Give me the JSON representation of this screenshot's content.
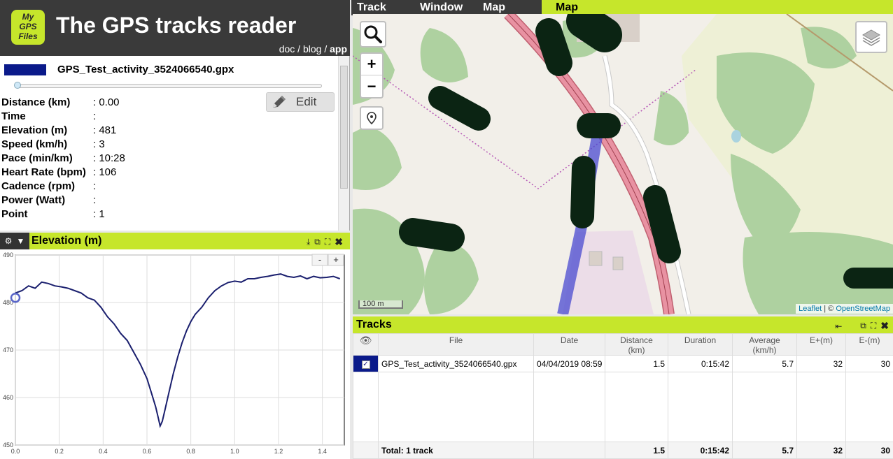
{
  "header": {
    "logo_lines": [
      "My",
      "GPS",
      "Files"
    ],
    "title": "The GPS tracks reader",
    "links": {
      "doc": "doc",
      "sep1": " / ",
      "blog": "blog",
      "sep2": " / ",
      "app": "app"
    }
  },
  "info": {
    "track_name": "GPS_Test_activity_3524066540.gpx",
    "track_color": "#0a1a8a",
    "edit_label": "Edit",
    "rows": [
      {
        "label": "Distance (km)",
        "value": ": 0.00"
      },
      {
        "label": "Time",
        "value": ":"
      },
      {
        "label": "Elevation (m)",
        "value": ": 481"
      },
      {
        "label": "Speed (km/h)",
        "value": ": 3"
      },
      {
        "label": "Pace (min/km)",
        "value": ": 10:28"
      },
      {
        "label": "Heart Rate (bpm)",
        "value": ": 106"
      },
      {
        "label": "Cadence (rpm)",
        "value": ":"
      },
      {
        "label": "Power (Watt)",
        "value": ":"
      },
      {
        "label": "Point",
        "value": ": 1"
      }
    ]
  },
  "elevation": {
    "title": "Elevation (m)",
    "zoom_out": "-",
    "zoom_in": "+"
  },
  "chart_data": {
    "type": "line",
    "xlabel": "",
    "ylabel": "",
    "xlim": [
      0,
      1.5
    ],
    "ylim": [
      450,
      490
    ],
    "xticks": [
      "0.0",
      "0.2",
      "0.4",
      "0.6",
      "0.8",
      "1.0",
      "1.2",
      "1.4"
    ],
    "yticks": [
      "450",
      "460",
      "470",
      "480",
      "490"
    ],
    "line_color": "#1a1f6e",
    "cursor_point": [
      0.0,
      481
    ],
    "x": [
      0.0,
      0.03,
      0.06,
      0.09,
      0.12,
      0.15,
      0.18,
      0.21,
      0.24,
      0.27,
      0.3,
      0.33,
      0.36,
      0.39,
      0.42,
      0.45,
      0.48,
      0.51,
      0.54,
      0.57,
      0.6,
      0.62,
      0.64,
      0.65,
      0.66,
      0.67,
      0.68,
      0.7,
      0.72,
      0.74,
      0.76,
      0.78,
      0.8,
      0.82,
      0.85,
      0.88,
      0.91,
      0.94,
      0.97,
      1.0,
      1.03,
      1.06,
      1.09,
      1.12,
      1.15,
      1.18,
      1.21,
      1.24,
      1.27,
      1.3,
      1.33,
      1.36,
      1.39,
      1.42,
      1.45,
      1.48
    ],
    "y": [
      482,
      482.5,
      483.5,
      483,
      484.3,
      484,
      483.5,
      483.3,
      483,
      482.5,
      482,
      481,
      480.5,
      479,
      477,
      475.5,
      473.5,
      472,
      469.5,
      467,
      464,
      461,
      458,
      456,
      454,
      455,
      457,
      461,
      465,
      468.5,
      471.5,
      474,
      476,
      477.5,
      479,
      481,
      482.5,
      483.5,
      484.2,
      484.5,
      484.3,
      485,
      485,
      485.3,
      485.5,
      485.8,
      486,
      485.5,
      485.3,
      485.6,
      485,
      485.5,
      485.2,
      485.3,
      485.5,
      485
    ]
  },
  "map": {
    "menu": [
      "Track",
      "Window",
      "Map"
    ],
    "tab_title": "Map",
    "zoom_in": "+",
    "zoom_out": "−",
    "scale": "100 m",
    "attribution_leaflet": "Leaflet",
    "attribution_sep": " | © ",
    "attribution_osm": "OpenStreetMap"
  },
  "tracks": {
    "title": "Tracks",
    "columns": [
      "File",
      "Date",
      "Distance\n(km)",
      "Duration",
      "Average\n(km/h)",
      "E+(m)",
      "E-(m)"
    ],
    "rows": [
      {
        "file": "GPS_Test_activity_3524066540.gpx",
        "date": "04/04/2019 08:59",
        "distance": "1.5",
        "duration": "0:15:42",
        "average": "5.7",
        "eplus": "32",
        "eminus": "30"
      }
    ],
    "total": {
      "label": "Total: 1 track",
      "distance": "1.5",
      "duration": "0:15:42",
      "average": "5.7",
      "eplus": "32",
      "eminus": "30"
    }
  }
}
